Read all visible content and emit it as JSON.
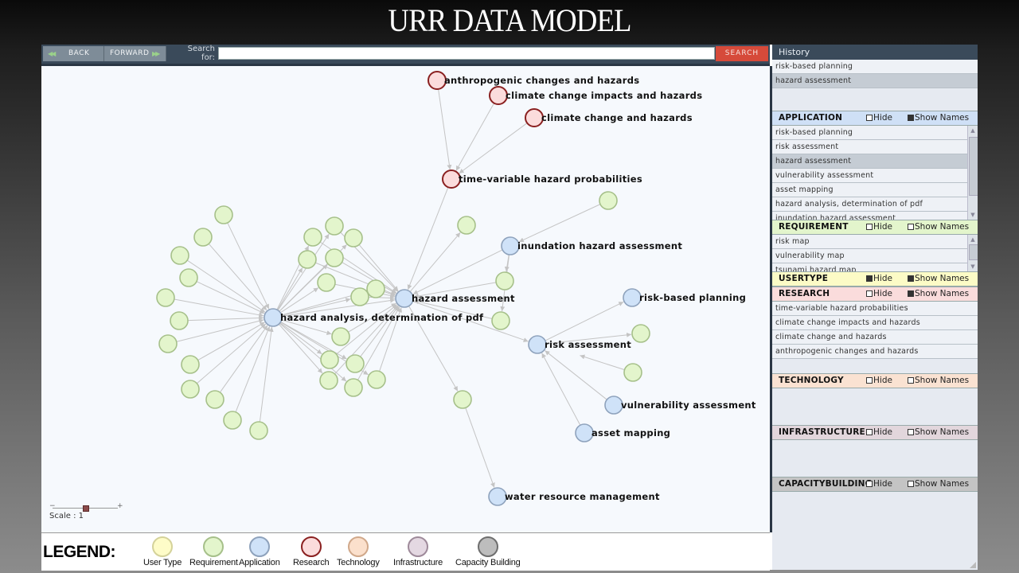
{
  "slide_title": "URR DATA MODEL",
  "toolbar": {
    "back_label": "BACK",
    "forward_label": "FORWARD",
    "search_label_line1": "Search",
    "search_label_line2": "for:",
    "search_value": "",
    "search_button": "SEARCH"
  },
  "graph": {
    "colors": {
      "user_type": {
        "fill": "#fefcc8",
        "stroke": "#d4d29a"
      },
      "requirement": {
        "fill": "#e3f5cc",
        "stroke": "#a6c08a"
      },
      "application": {
        "fill": "#cfe2f8",
        "stroke": "#8ea2bc"
      },
      "research": {
        "fill": "#fbdcdc",
        "stroke": "#8a2020"
      },
      "technology": {
        "fill": "#fbe0cc",
        "stroke": "#d0a88a"
      },
      "infrastructure": {
        "fill": "#e4d8e2",
        "stroke": "#9e8a9a"
      },
      "capacity_building": {
        "fill": "#bdbdbd",
        "stroke": "#6e6e6e"
      },
      "edge": "#c4c4c4"
    },
    "nodes": [
      {
        "id": "anthro",
        "type": "research",
        "label": "anthropogenic changes and hazards"
      },
      {
        "id": "ccih",
        "type": "research",
        "label": "climate change impacts and hazards"
      },
      {
        "id": "cch",
        "type": "research",
        "label": "climate change and hazards"
      },
      {
        "id": "tvhp",
        "type": "research",
        "label": "time-variable hazard probabilities"
      },
      {
        "id": "iha",
        "type": "application",
        "label": "inundation hazard assessment"
      },
      {
        "id": "ha",
        "type": "application",
        "label": "hazard assessment"
      },
      {
        "id": "hadp",
        "type": "application",
        "label": "hazard analysis, determination of pdf"
      },
      {
        "id": "rbp",
        "type": "application",
        "label": "risk-based planning"
      },
      {
        "id": "ra",
        "type": "application",
        "label": "risk assessment"
      },
      {
        "id": "va",
        "type": "application",
        "label": "vulnerability assessment"
      },
      {
        "id": "am",
        "type": "application",
        "label": "asset mapping"
      },
      {
        "id": "wrm",
        "type": "application",
        "label": "water resource management"
      }
    ],
    "unlabeled_requirement_count": 33
  },
  "scale": {
    "label": "Scale : 1",
    "value": 1,
    "minus": "−",
    "plus": "+"
  },
  "legend": {
    "title": "LEGEND:",
    "items": [
      {
        "label": "User Type",
        "type": "user_type"
      },
      {
        "label": "Requirement",
        "type": "requirement"
      },
      {
        "label": "Application",
        "type": "application"
      },
      {
        "label": "Research",
        "type": "research"
      },
      {
        "label": "Technology",
        "type": "technology"
      },
      {
        "label": "Infrastructure",
        "type": "infrastructure"
      },
      {
        "label": "Capacity Building",
        "type": "capacity_building"
      }
    ]
  },
  "history": {
    "title": "History",
    "items": [
      "risk-based planning",
      "hazard assessment"
    ],
    "selected_index": 1
  },
  "sections": {
    "hide_label": "Hide",
    "show_names_label": "Show Names",
    "application": {
      "title": "APPLICATION",
      "color": "#cfe0f6",
      "hide": false,
      "show_names": true,
      "items": [
        "risk-based planning",
        "risk assessment",
        "hazard assessment",
        "vulnerability assessment",
        "asset mapping",
        "hazard analysis, determination of pdf",
        "inundation hazard assessment"
      ],
      "selected_index": 2
    },
    "requirement": {
      "title": "REQUIREMENT",
      "color": "#e3f5cc",
      "hide": false,
      "show_names": false,
      "items": [
        "risk map",
        "vulnerability map",
        "tsunami hazard map"
      ]
    },
    "usertype": {
      "title": "USERTYPE",
      "color": "#fcfbc6",
      "hide": true,
      "show_names": true,
      "items": []
    },
    "research": {
      "title": "RESEARCH",
      "color": "#fadcdc",
      "hide": false,
      "show_names": true,
      "items": [
        "time-variable hazard probabilities",
        "climate change impacts and hazards",
        "climate change and hazards",
        "anthropogenic changes and hazards"
      ]
    },
    "technology": {
      "title": "TECHNOLOGY",
      "color": "#fae2d2",
      "hide": false,
      "show_names": false,
      "items": []
    },
    "infrastructure": {
      "title": "INFRASTRUCTURE",
      "color": "#e2d6dc",
      "hide": false,
      "show_names": false,
      "items": []
    },
    "capacitybuilding": {
      "title": "CAPACITYBUILDING",
      "color": "#c4c4c4",
      "hide": false,
      "show_names": false,
      "items": []
    }
  }
}
